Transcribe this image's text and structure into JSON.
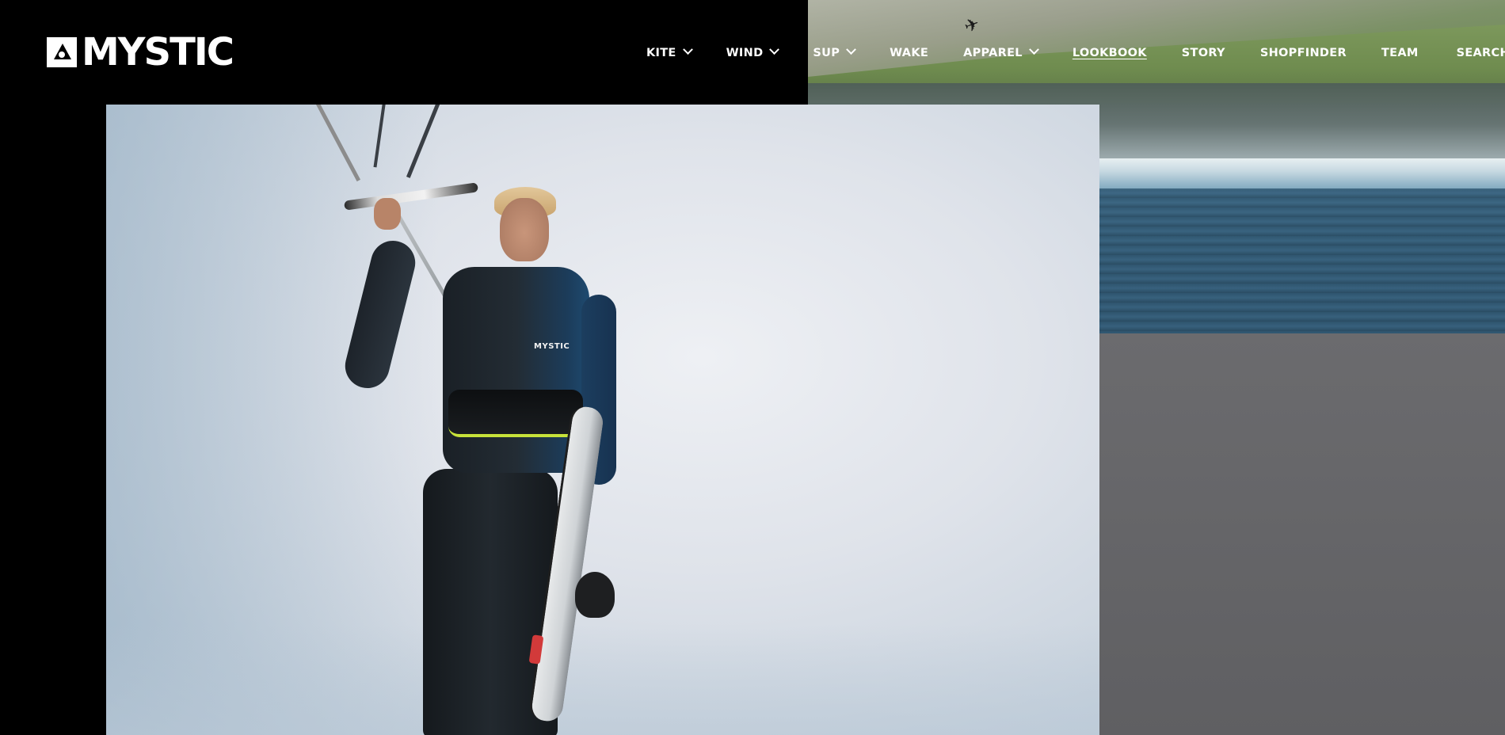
{
  "brand": {
    "logo_text": "MYSTIC"
  },
  "nav": {
    "items": [
      {
        "label": "KITE",
        "has_dropdown": true
      },
      {
        "label": "WIND",
        "has_dropdown": true
      },
      {
        "label": "SUP",
        "has_dropdown": true
      },
      {
        "label": "WAKE",
        "has_dropdown": false
      },
      {
        "label": "APPAREL",
        "has_dropdown": true
      },
      {
        "label": "LOOKBOOK",
        "has_dropdown": false,
        "active": true
      },
      {
        "label": "STORY",
        "has_dropdown": false
      },
      {
        "label": "SHOPFINDER",
        "has_dropdown": false
      },
      {
        "label": "TEAM",
        "has_dropdown": false
      },
      {
        "label": "SEARCH",
        "has_dropdown": false,
        "icon": "search-icon"
      }
    ]
  },
  "photos": {
    "hero": {
      "subject": "kitesurfer-with-board",
      "brand_on_harness": "MYSTIC"
    },
    "secondary": {
      "subject": "coastline-with-kiter"
    }
  },
  "colors": {
    "header_bg": "#000000",
    "nav_text": "#ffffff",
    "panel_grey": "#5f5f62"
  }
}
